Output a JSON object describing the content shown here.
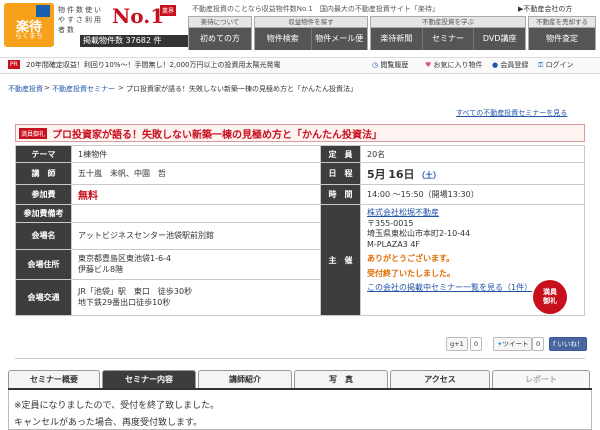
{
  "header": {
    "logo_title": "楽待",
    "logo_sub": "らくまち",
    "slogan": "物件数使いやすさ利用者数",
    "no1": "No.1",
    "no1_badge": "業界",
    "count": "掲載物件数 37682 件",
    "tagline": "不動産投資のことなら収益物件数No.1　国内最大の不動産投資サイト「楽待」",
    "corp_link": "▶不動産会社の方",
    "tab_groups": [
      {
        "head": "楽待について",
        "items": [
          "初めての方"
        ]
      },
      {
        "head": "収益物件を探す",
        "items": [
          "物件検索",
          "物件メール便"
        ]
      },
      {
        "head": "不動産投資を学ぶ",
        "items": [
          "楽待新聞",
          "セミナー",
          "DVD講座"
        ]
      },
      {
        "head": "不動産を売却する",
        "items": [
          "物件査定"
        ]
      }
    ]
  },
  "pr": {
    "badge": "PR",
    "text": "20年間確定収益！利回り10%～！手間無し！2,000万円以上の投資用太陽光発電"
  },
  "util_links": [
    "閲覧履歴",
    "お気に入り物件",
    "会員登録",
    "ログイン"
  ],
  "breadcrumb": [
    "不動産投資",
    "不動産投資セミナー",
    "プロ投資家が語る！失敗しない新築一棟の見極め方と「かんたん投資法」"
  ],
  "all_seminars_link": "すべての不動産投資セミナーを見る",
  "seminar": {
    "badge": "満員御礼",
    "title": "プロ投資家が語る！失敗しない新築一棟の見極め方と「かんたん投資法」",
    "labels": {
      "theme": "テーマ",
      "capacity": "定　員",
      "lecturer": "講　師",
      "date": "日　程",
      "fee": "参加費",
      "time": "時　間",
      "notes": "参加費備考",
      "venue": "会場名",
      "organizer": "主　催",
      "address": "会場住所",
      "access": "会場交通"
    },
    "theme": "1棟物件",
    "capacity": "20名",
    "lecturer": "五十嵐　未帆、中園　哲",
    "date_month": "5月",
    "date_day": "16日",
    "date_weekday": "（土）",
    "fee": "無料",
    "time": "14:00 ～15:50（開場13:30）",
    "notes": "",
    "venue": "アットビジネスセンター池袋駅前別館",
    "address_1": "東京都豊島区東池袋1-6-4",
    "address_2": "伊藤ビル8階",
    "access_1": "JR「池袋」駅　東口　徒歩30秒",
    "access_2": "地下鉄29番出口徒歩10秒",
    "org_name": "株式会社松堀不動産",
    "org_zip": "〒355-0015",
    "org_addr": "埼玉県東松山市本町2-10-44",
    "org_bldg": "M-PLAZA3 4F",
    "thanks_1": "ありがとうございます。",
    "thanks_2": "受付終了いたしました。",
    "more_link": "この会社の掲載中セミナー一覧を見る（1件）",
    "seal_1": "満員",
    "seal_2": "御礼"
  },
  "share": {
    "gplus": "g+1",
    "gplus_count": "0",
    "tweet": "ツイート",
    "tweet_count": "0",
    "like": "いいね！"
  },
  "tabs": [
    "セミナー概要",
    "セミナー内容",
    "講師紹介",
    "写　真",
    "アクセス",
    "レポート"
  ],
  "content_lines": [
    "※定員になりましたので、受付を終了致しました。",
    "キャンセルがあった場合、再度受付致します。"
  ]
}
